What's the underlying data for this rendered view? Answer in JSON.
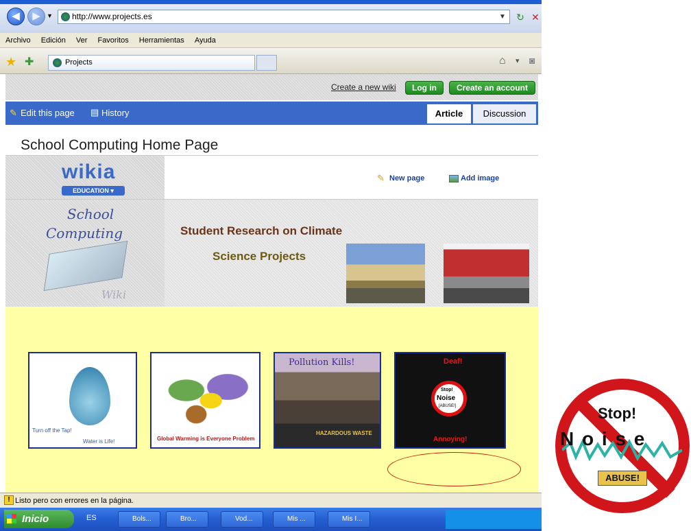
{
  "browser": {
    "url": "http://www.projects.es",
    "menu": [
      "Archivo",
      "Edición",
      "Ver",
      "Favoritos",
      "Herramientas",
      "Ayuda"
    ],
    "tab_title": "Projects",
    "status_text": "Listo pero con errores en la página."
  },
  "wiki": {
    "create_wiki": "Create a new wiki",
    "login": "Log in",
    "create_account": "Create an account",
    "edit_page": "Edit this page",
    "history": "History",
    "tab_article": "Article",
    "tab_discussion": "Discussion",
    "page_title": "School Computing Home Page",
    "logo": "wikia",
    "logo_sub": "EDUCATION ▾",
    "new_page": "New page",
    "add_image": "Add image"
  },
  "banner": {
    "school_line1": "School",
    "school_line2": "Computing",
    "wiki_word": "Wiki",
    "line1": "Student Research on Climate",
    "line2": "Science Projects"
  },
  "cards": [
    {
      "caption1": "Turn off the Tap!",
      "caption2": "Water is Life!"
    },
    {
      "caption1": "Global Warming is Everyone Problem"
    },
    {
      "caption1": "Pollution Kills!",
      "caption2": "HAZARDOUS WASTE"
    },
    {
      "caption1": "Deaf!",
      "caption2": "Annoying!",
      "sign_top": "Stop!",
      "sign_mid": "Noise",
      "sign_bot": "[ABUSE!]"
    }
  ],
  "taskbar": {
    "start": "Inicio",
    "lang": "ES",
    "items": [
      "Bols...",
      "Bro...",
      "Vod...",
      "Mis ...",
      "Mis I..."
    ]
  },
  "sign": {
    "top": "Stop!",
    "mid": "N o i s e",
    "bot": "ABUSE!"
  }
}
